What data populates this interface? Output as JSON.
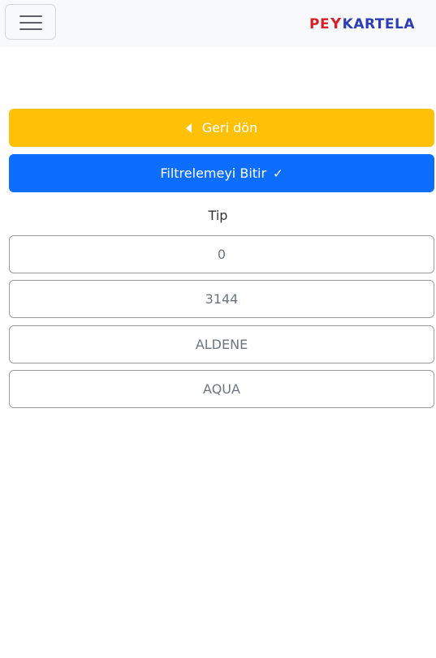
{
  "header": {
    "menu_icon": "hamburger-menu-icon",
    "logo": {
      "part1": "PE",
      "part2": "Y",
      "part3": "KARTELA",
      "color_red": "#d4202a",
      "color_blue": "#2d3db4"
    }
  },
  "actions": {
    "back_label": "Geri dön",
    "back_icon": "caret-left-icon",
    "finish_label": "Filtrelemeyi Bitir",
    "finish_icon": "check-icon"
  },
  "filter": {
    "title": "Tip",
    "options": [
      "0",
      "3144",
      "ALDENE",
      "AQUA"
    ]
  },
  "colors": {
    "warning": "#ffc107",
    "primary": "#0d6efd"
  }
}
